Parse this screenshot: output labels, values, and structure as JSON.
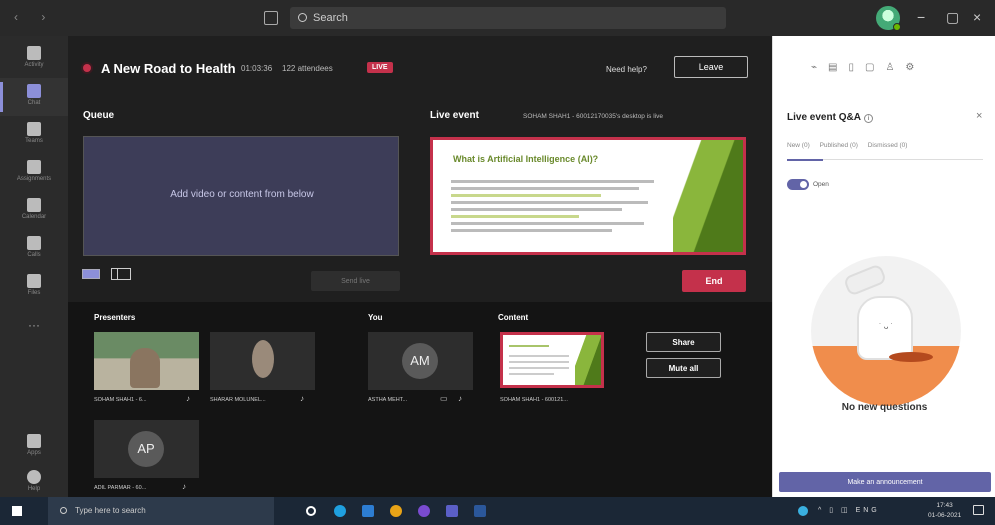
{
  "titlebar": {
    "search_placeholder": "Search",
    "nav": "‹ ›",
    "controls": [
      "−",
      "▢",
      "×"
    ]
  },
  "rail": {
    "items": [
      {
        "label": "Activity",
        "active": false
      },
      {
        "label": "Chat",
        "active": true
      },
      {
        "label": "Teams",
        "active": false
      },
      {
        "label": "Assignments",
        "active": false
      },
      {
        "label": "Calendar",
        "active": false
      },
      {
        "label": "Calls",
        "active": false
      },
      {
        "label": "Files",
        "active": false
      }
    ],
    "more": "···",
    "bottom": [
      {
        "label": "Apps"
      },
      {
        "label": "Help"
      }
    ]
  },
  "event": {
    "title": "A New Road to Health",
    "time": "01:03:36",
    "attendees": "122 attendees",
    "live_badge": "LIVE",
    "need_help": "Need help?",
    "leave": "Leave"
  },
  "queue": {
    "label": "Queue",
    "placeholder": "Add video or content from below",
    "send_live": "Send live"
  },
  "live": {
    "label": "Live event",
    "info": "SOHAM SHAH1 - 60012170035's desktop is live",
    "slide_title": "What is Artificial Intelligence (AI)?",
    "end": "End"
  },
  "strip": {
    "presenters_label": "Presenters",
    "you_label": "You",
    "content_label": "Content",
    "presenters": [
      {
        "name": "SOHAM SHAH1 - 6..."
      },
      {
        "name": "SHARAR MOLUNEL..."
      },
      {
        "name": "ADIL PARMAR - 60...",
        "initials": "AP"
      }
    ],
    "you": {
      "name": "ASTHA MEHT...",
      "initials": "AM"
    },
    "content": {
      "name": "SOHAM SHAH1 - 600121..."
    },
    "share": "Share",
    "mute_all": "Mute all"
  },
  "qa": {
    "title": "Live event Q&A",
    "tabs": [
      "New (0)",
      "Published (0)",
      "Dismissed (0)"
    ],
    "toggle_label": "Open",
    "empty": "No new questions",
    "announce": "Make an announcement"
  },
  "taskbar": {
    "search_placeholder": "Type here to search",
    "tray": "^ ▯ ◫ ENG",
    "time": "17:43",
    "date": "01-06-2021"
  },
  "colors": {
    "accent": "#6264a7",
    "live_red": "#c4314b",
    "slide_green": "#8ab63c"
  }
}
